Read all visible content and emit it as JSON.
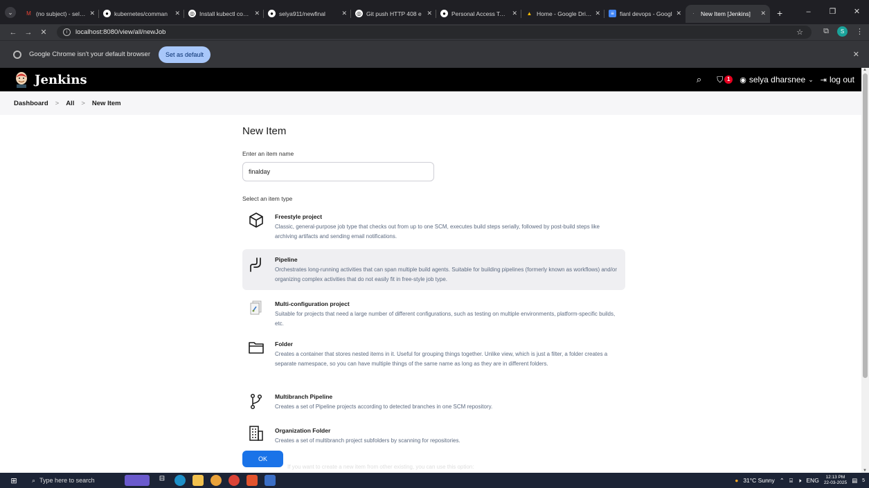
{
  "browser": {
    "tabs": [
      {
        "title": "(no subject) - selyadh",
        "favicon_color": "#ea4335",
        "favicon_glyph": "M"
      },
      {
        "title": "kubernetes/comman",
        "favicon_color": "#ffffff",
        "favicon_glyph": "●"
      },
      {
        "title": "Install kubectl comm",
        "favicon_color": "#ffffff",
        "favicon_glyph": "◎"
      },
      {
        "title": "selya911/newfinal",
        "favicon_color": "#ffffff",
        "favicon_glyph": "●"
      },
      {
        "title": "Git push HTTP 408 e",
        "favicon_color": "#ffffff",
        "favicon_glyph": "◎"
      },
      {
        "title": "Personal Access Toke",
        "favicon_color": "#ffffff",
        "favicon_glyph": "●"
      },
      {
        "title": "Home - Google Drive",
        "favicon_color": "#fbbc04",
        "favicon_glyph": "▲"
      },
      {
        "title": "fianl devops - Googl",
        "favicon_color": "#4285f4",
        "favicon_glyph": "≡"
      },
      {
        "title": "New Item [Jenkins]",
        "favicon_color": "#35363a",
        "favicon_glyph": "·"
      }
    ],
    "url": "localhost:8080/view/all/newJob",
    "profile_initial": "S",
    "banner_message": "Google Chrome isn't your default browser",
    "banner_button": "Set as default"
  },
  "jenkins": {
    "brand": "Jenkins",
    "security_count": "1",
    "user_name": "selya dharsnee",
    "logout_label": "log out",
    "breadcrumb": [
      "Dashboard",
      "All",
      "New Item"
    ]
  },
  "form": {
    "title": "New Item",
    "name_label": "Enter an item name",
    "name_value": "finalday",
    "type_label": "Select an item type",
    "ok_label": "OK",
    "copy_hint": "If you want to create a new item from other existing, you can use this option:"
  },
  "item_types": [
    {
      "name": "Freestyle project",
      "icon": "cube-icon",
      "desc": "Classic, general-purpose job type that checks out from up to one SCM, executes build steps serially, followed by post-build steps like archiving artifacts and sending email notifications."
    },
    {
      "name": "Pipeline",
      "icon": "pipeline-icon",
      "desc": "Orchestrates long-running activities that can span multiple build agents. Suitable for building pipelines (formerly known as workflows) and/or organizing complex activities that do not easily fit in free-style job type."
    },
    {
      "name": "Multi-configuration project",
      "icon": "multi-config-icon",
      "desc": "Suitable for projects that need a large number of different configurations, such as testing on multiple environments, platform-specific builds, etc."
    },
    {
      "name": "Folder",
      "icon": "folder-icon",
      "desc": "Creates a container that stores nested items in it. Useful for grouping things together. Unlike view, which is just a filter, a folder creates a separate namespace, so you can have multiple things of the same name as long as they are in different folders."
    },
    {
      "name": "Multibranch Pipeline",
      "icon": "branch-icon",
      "desc": "Creates a set of Pipeline projects according to detected branches in one SCM repository."
    },
    {
      "name": "Organization Folder",
      "icon": "building-icon",
      "desc": "Creates a set of multibranch project subfolders by scanning for repositories."
    }
  ],
  "taskbar": {
    "search_placeholder": "Type here to search",
    "weather": "31°C Sunny",
    "language": "ENG",
    "time": "12:13 PM",
    "date": "22-03-2025",
    "notif_count": "5"
  }
}
